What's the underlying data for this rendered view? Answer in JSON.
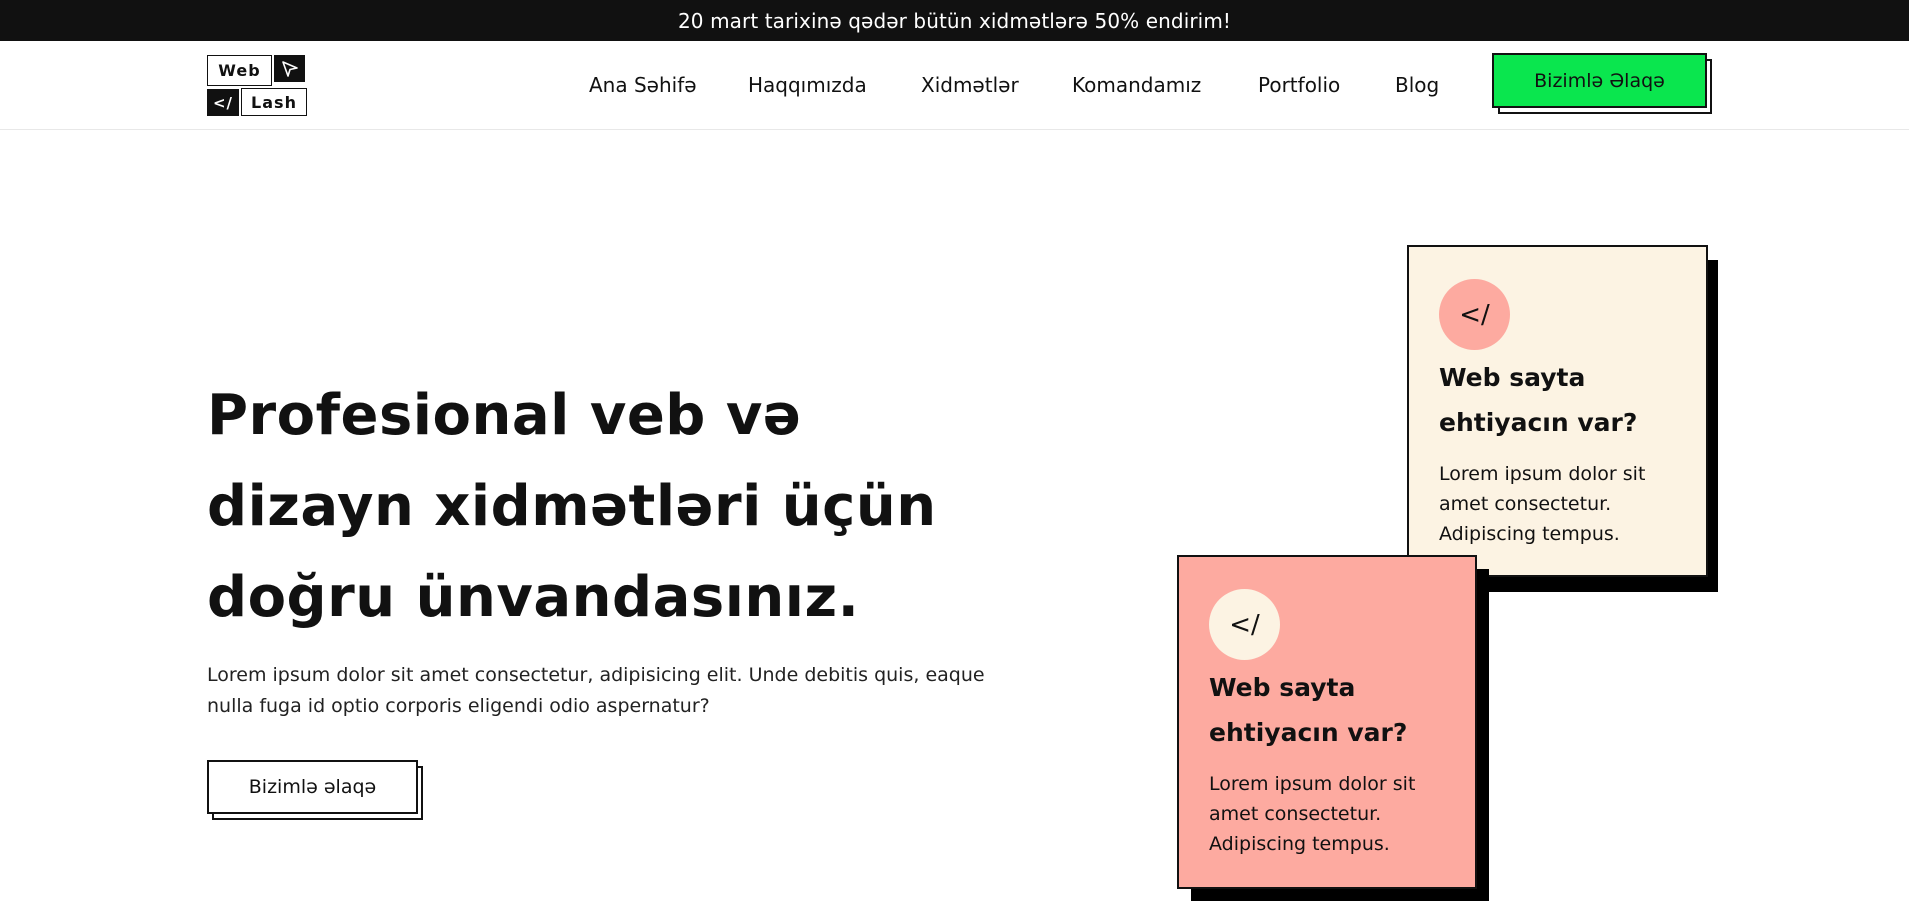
{
  "promo": {
    "text": "20 mart tarixinə qədər bütün xidmətlərə 50% endirim!"
  },
  "logo": {
    "word1": "Web",
    "word2": "Lash",
    "code": "</",
    "arrow_icon": "cursor-arrow-icon"
  },
  "nav": {
    "items": [
      {
        "label": "Ana Səhifə"
      },
      {
        "label": "Haqqımızda"
      },
      {
        "label": "Xidmətlər"
      },
      {
        "label": "Komandamız"
      },
      {
        "label": "Portfolio"
      },
      {
        "label": "Blog"
      }
    ],
    "cta_label": "Bizimlə Əlaqə"
  },
  "hero": {
    "title_lines": [
      "Profesional veb və",
      "dizayn xidmətləri üçün",
      "doğru ünvandasınız."
    ],
    "description": "Lorem ipsum dolor sit amet consectetur, adipisicing elit. Unde debitis quis, eaque nulla fuga id optio corporis eligendi odio aspernatur?",
    "button_label": "Bizimlə əlaqə"
  },
  "cards": [
    {
      "icon": "</",
      "title": "Web sayta ehtiyacın var?",
      "text": "Lorem ipsum dolor sit amet consectetur. Adipiscing tempus."
    },
    {
      "icon": "</",
      "title": "Web sayta ehtiyacın var?",
      "text": "Lorem ipsum dolor sit amet consectetur. Adipiscing tempus."
    }
  ],
  "colors": {
    "accent_green": "#0ae64e",
    "card_cream": "#fcf3e3",
    "card_salmon": "#fdaaa0",
    "dark": "#111111"
  }
}
